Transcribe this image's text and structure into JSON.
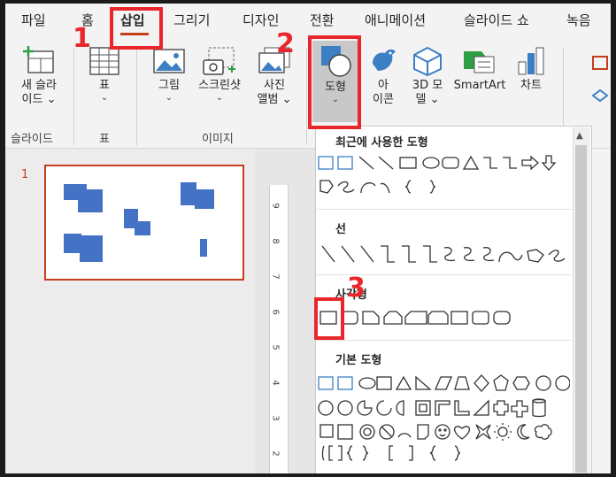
{
  "tabs": [
    "파일",
    "홈",
    "삽입",
    "그리기",
    "디자인",
    "전환",
    "애니메이션",
    "슬라이드 쇼",
    "녹음"
  ],
  "ribbon": {
    "new_slide_line1": "새 슬라",
    "new_slide_line2": "이드 ⌄",
    "table": "표",
    "picture": "그림",
    "screenshot": "스크린샷",
    "photo_album_line1": "사진",
    "photo_album_line2": "앨범 ⌄",
    "shapes": "도형",
    "icons_line1": "아",
    "icons_line2": "이콘",
    "models_line1": "3D 모",
    "models_line2": "델 ⌄",
    "smartart": "SmartArt",
    "chart": "차트",
    "chevron": "⌄"
  },
  "groups": {
    "slides": "슬라이드",
    "tables": "표",
    "images": "이미지"
  },
  "slides_panel": {
    "number": "1"
  },
  "ruler_labels": [
    "9",
    "8",
    "7",
    "6",
    "5",
    "4",
    "3",
    "2"
  ],
  "dropdown": {
    "recent": "최근에 사용한 도형",
    "lines": "선",
    "rectangles": "사각형",
    "basic": "기본 도형"
  },
  "callouts": [
    "1",
    "2",
    "3"
  ],
  "colors": {
    "accent": "#c43e1c",
    "highlight": "#e8262c",
    "shape_blue": "#4472c4"
  }
}
